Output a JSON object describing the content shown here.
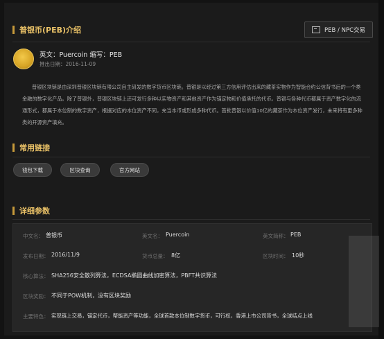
{
  "intro": {
    "section_title": "普银币(PEB)介绍",
    "trade_button": "PEB / NPC交易",
    "coin_name_line": "英文：Puercoin 缩写：PEB",
    "release_line": "推出日期：2016-11-09",
    "description": "普银区块链是由深圳普银区块链有限公司自主研发的数字货币区块链。普银是以经过第三方信用评估出来的藏茶实物作为智能合约公信背书后的一个类金融的数字化产品。除了普银外，普银区块链上还可发行多种以实物资产和其他资产作为锚定物和价值承托的代币。普银与各种代币都属于资产数字化的流通形式，都属于本位制的数字资产，根据对应的本位资产不同，充当本币或形成多种代币。首批普银以价值10亿的藏茶作为本位资产发行，未来将有更多种类的开源资产填充。"
  },
  "links": {
    "section_title": "常用链接",
    "items": [
      "钱包下载",
      "区块查询",
      "官方网站"
    ]
  },
  "params": {
    "section_title": "详细参数",
    "row1": {
      "cn_label": "中文名：",
      "cn_value": "普银币",
      "en_label": "英文名：",
      "en_value": "Puercoin",
      "abbr_label": "英文简称：",
      "abbr_value": "PEB"
    },
    "row2": {
      "date_label": "发布日期：",
      "date_value": "2016/11/9",
      "supply_label": "货币总量：",
      "supply_value": "8亿",
      "block_label": "区块时间：",
      "block_value": "10秒"
    },
    "row3": {
      "label": "核心算法：",
      "value": "SHA256安全散列算法，ECDSA椭圆曲线加密算法，PBFT共识算法"
    },
    "row4": {
      "label": "区块奖励：",
      "value": "不同于POW机制，没有区块奖励"
    },
    "row5": {
      "label": "主要特色：",
      "value": "实现链上交易，锚定代币，帮能资产等功能，全球首款本位制数字货币，可行权，香港上市公司背书，全球结点上线"
    }
  },
  "colors": {
    "accent": "#e9c167",
    "background": "#1b1b1b"
  }
}
